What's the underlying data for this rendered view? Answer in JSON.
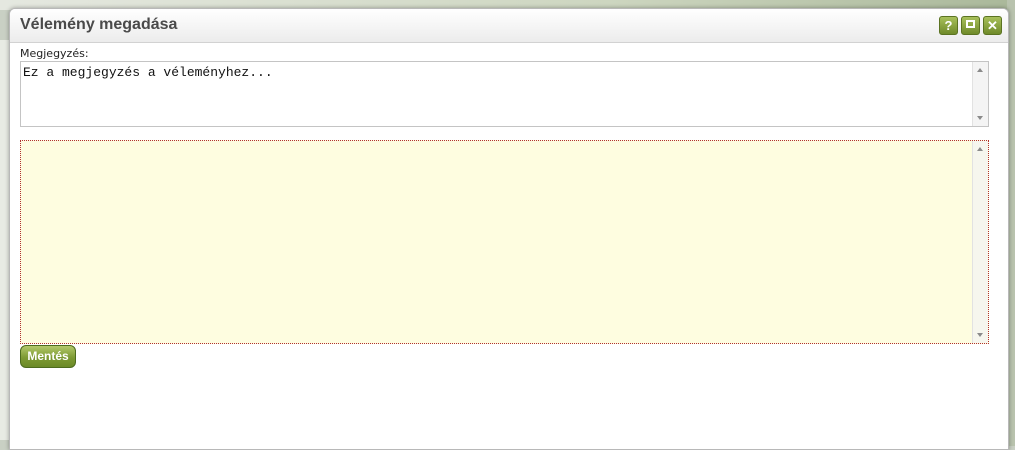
{
  "dialog": {
    "title": "Vélemény megadása",
    "buttons": {
      "help_label": "?",
      "maximize_icon": "maximize-icon",
      "close_label": "✕"
    }
  },
  "form": {
    "note_label": "Megjegyzés:",
    "note_value": "Ez a megjegyzés a véleményhez...",
    "editor_value": "",
    "save_label": "Mentés"
  },
  "colors": {
    "accent": "#7d9a33",
    "editor_background": "#fefde0",
    "editor_border": "#b03030"
  }
}
